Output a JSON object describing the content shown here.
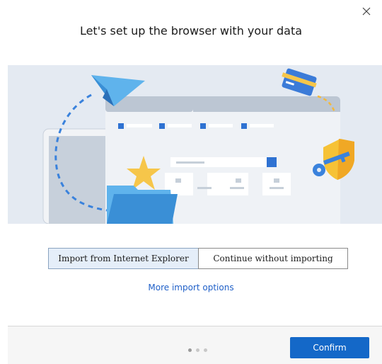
{
  "dialog": {
    "title": "Let's set up the browser with your data",
    "close_icon": "close-icon"
  },
  "illustration": {
    "icons": [
      "paper-plane-icon",
      "credit-card-icon",
      "browser-window-icon",
      "star-icon",
      "folder-icon",
      "shield-icon",
      "key-icon"
    ]
  },
  "import_choice": {
    "options": [
      {
        "label": "Import from Internet Explorer",
        "selected": true
      },
      {
        "label": "Continue without importing",
        "selected": false
      }
    ]
  },
  "more_options": {
    "label": "More import options"
  },
  "footer": {
    "page_indicator": {
      "total": 3,
      "current": 1
    },
    "confirm_label": "Confirm"
  },
  "colors": {
    "accent": "#1468c8",
    "link": "#2060c8",
    "illustration_bg": "#e4eaf2"
  }
}
